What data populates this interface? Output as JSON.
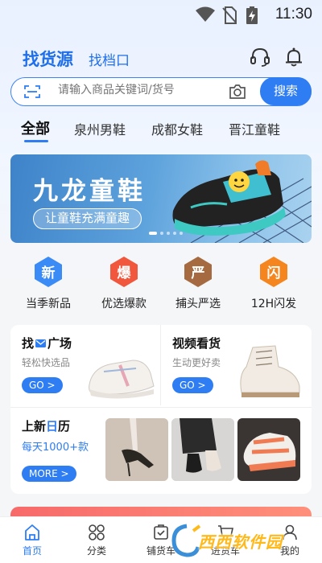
{
  "status_bar": {
    "time": "11:30"
  },
  "header": {
    "tab_main": "找货源",
    "tab_sub": "找档口"
  },
  "search": {
    "placeholder": "请输入商品关键词/货号",
    "button_label": "搜索"
  },
  "categories": [
    {
      "label": "全部",
      "active": true
    },
    {
      "label": "泉州男鞋",
      "active": false
    },
    {
      "label": "成都女鞋",
      "active": false
    },
    {
      "label": "晋江童鞋",
      "active": false
    }
  ],
  "banner": {
    "title": "九龙童鞋",
    "subtitle": "让童鞋充满童趣"
  },
  "quick_entries": [
    {
      "glyph": "新",
      "label": "当季新品",
      "color": "#3a8bf5"
    },
    {
      "glyph": "爆",
      "label": "优选爆款",
      "color": "#f0573d"
    },
    {
      "glyph": "严",
      "label": "捕头严选",
      "color": "#a56a3f"
    },
    {
      "glyph": "闪",
      "label": "12H闪发",
      "color": "#f5861f"
    }
  ],
  "feature_cards": {
    "find_square": {
      "title_a": "找",
      "title_b": "广场",
      "subtitle": "轻松快选品",
      "button": "GO >"
    },
    "video": {
      "title": "视频看货",
      "subtitle": "生动更好卖",
      "button": "GO >"
    },
    "new_calendar": {
      "title_a": "上新",
      "title_highlight": "日",
      "title_b": "历",
      "subtitle": "每天1000+款",
      "button": "MORE >"
    }
  },
  "bottom_nav": [
    {
      "label": "首页",
      "icon": "home-icon",
      "active": true
    },
    {
      "label": "分类",
      "icon": "grid-icon",
      "active": false
    },
    {
      "label": "铺货车",
      "icon": "cart-icon",
      "active": false
    },
    {
      "label": "进货车",
      "icon": "purchase-icon",
      "active": false
    },
    {
      "label": "我的",
      "icon": "profile-icon",
      "active": false
    }
  ],
  "watermark": {
    "text": "西西软件园"
  },
  "colors": {
    "accent": "#2e7df3",
    "brand_text": "#1f6fe8"
  }
}
